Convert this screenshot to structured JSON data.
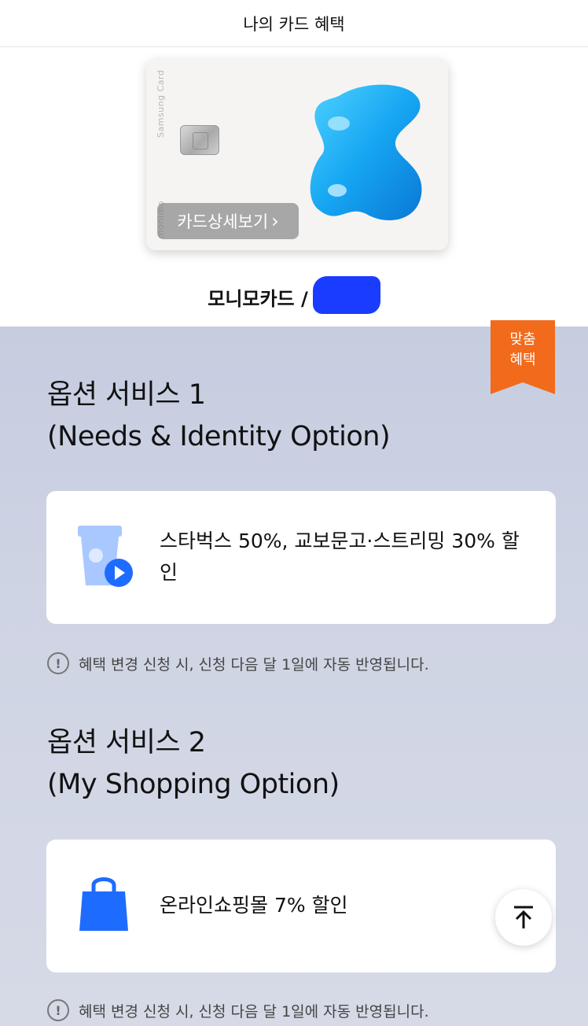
{
  "header": {
    "title": "나의 카드 혜택"
  },
  "card": {
    "brand_vertical": "Samsung Card",
    "brand_vertical2": "monimo",
    "detail_button": "카드상세보기",
    "chevron": "›",
    "name": "모니모카드 /"
  },
  "badge": {
    "line1": "맞춤",
    "line2": "혜택"
  },
  "sections": [
    {
      "title_line1": "옵션 서비스 1",
      "title_line2": "(Needs & Identity Option)",
      "benefit": "스타벅스 50%, 교보문고·스트리밍 30% 할인",
      "icon": "coffee-cup-play-icon",
      "notice": "혜택 변경 신청 시, 신청 다음 달 1일에 자동 반영됩니다."
    },
    {
      "title_line1": "옵션 서비스 2",
      "title_line2": "(My Shopping Option)",
      "benefit": "온라인쇼핑몰 7% 할인",
      "icon": "shopping-bag-icon",
      "notice": "혜택 변경 신청 시, 신청 다음 달 1일에 자동 반영됩니다."
    }
  ],
  "colors": {
    "accent_orange": "#f26a1b",
    "icon_blue": "#1e6bff",
    "icon_light_blue": "#a9c8ff",
    "background": "#cfd4e4"
  },
  "icons": {
    "info": "info-circle-icon",
    "scroll_top": "arrow-up-to-top-icon"
  }
}
